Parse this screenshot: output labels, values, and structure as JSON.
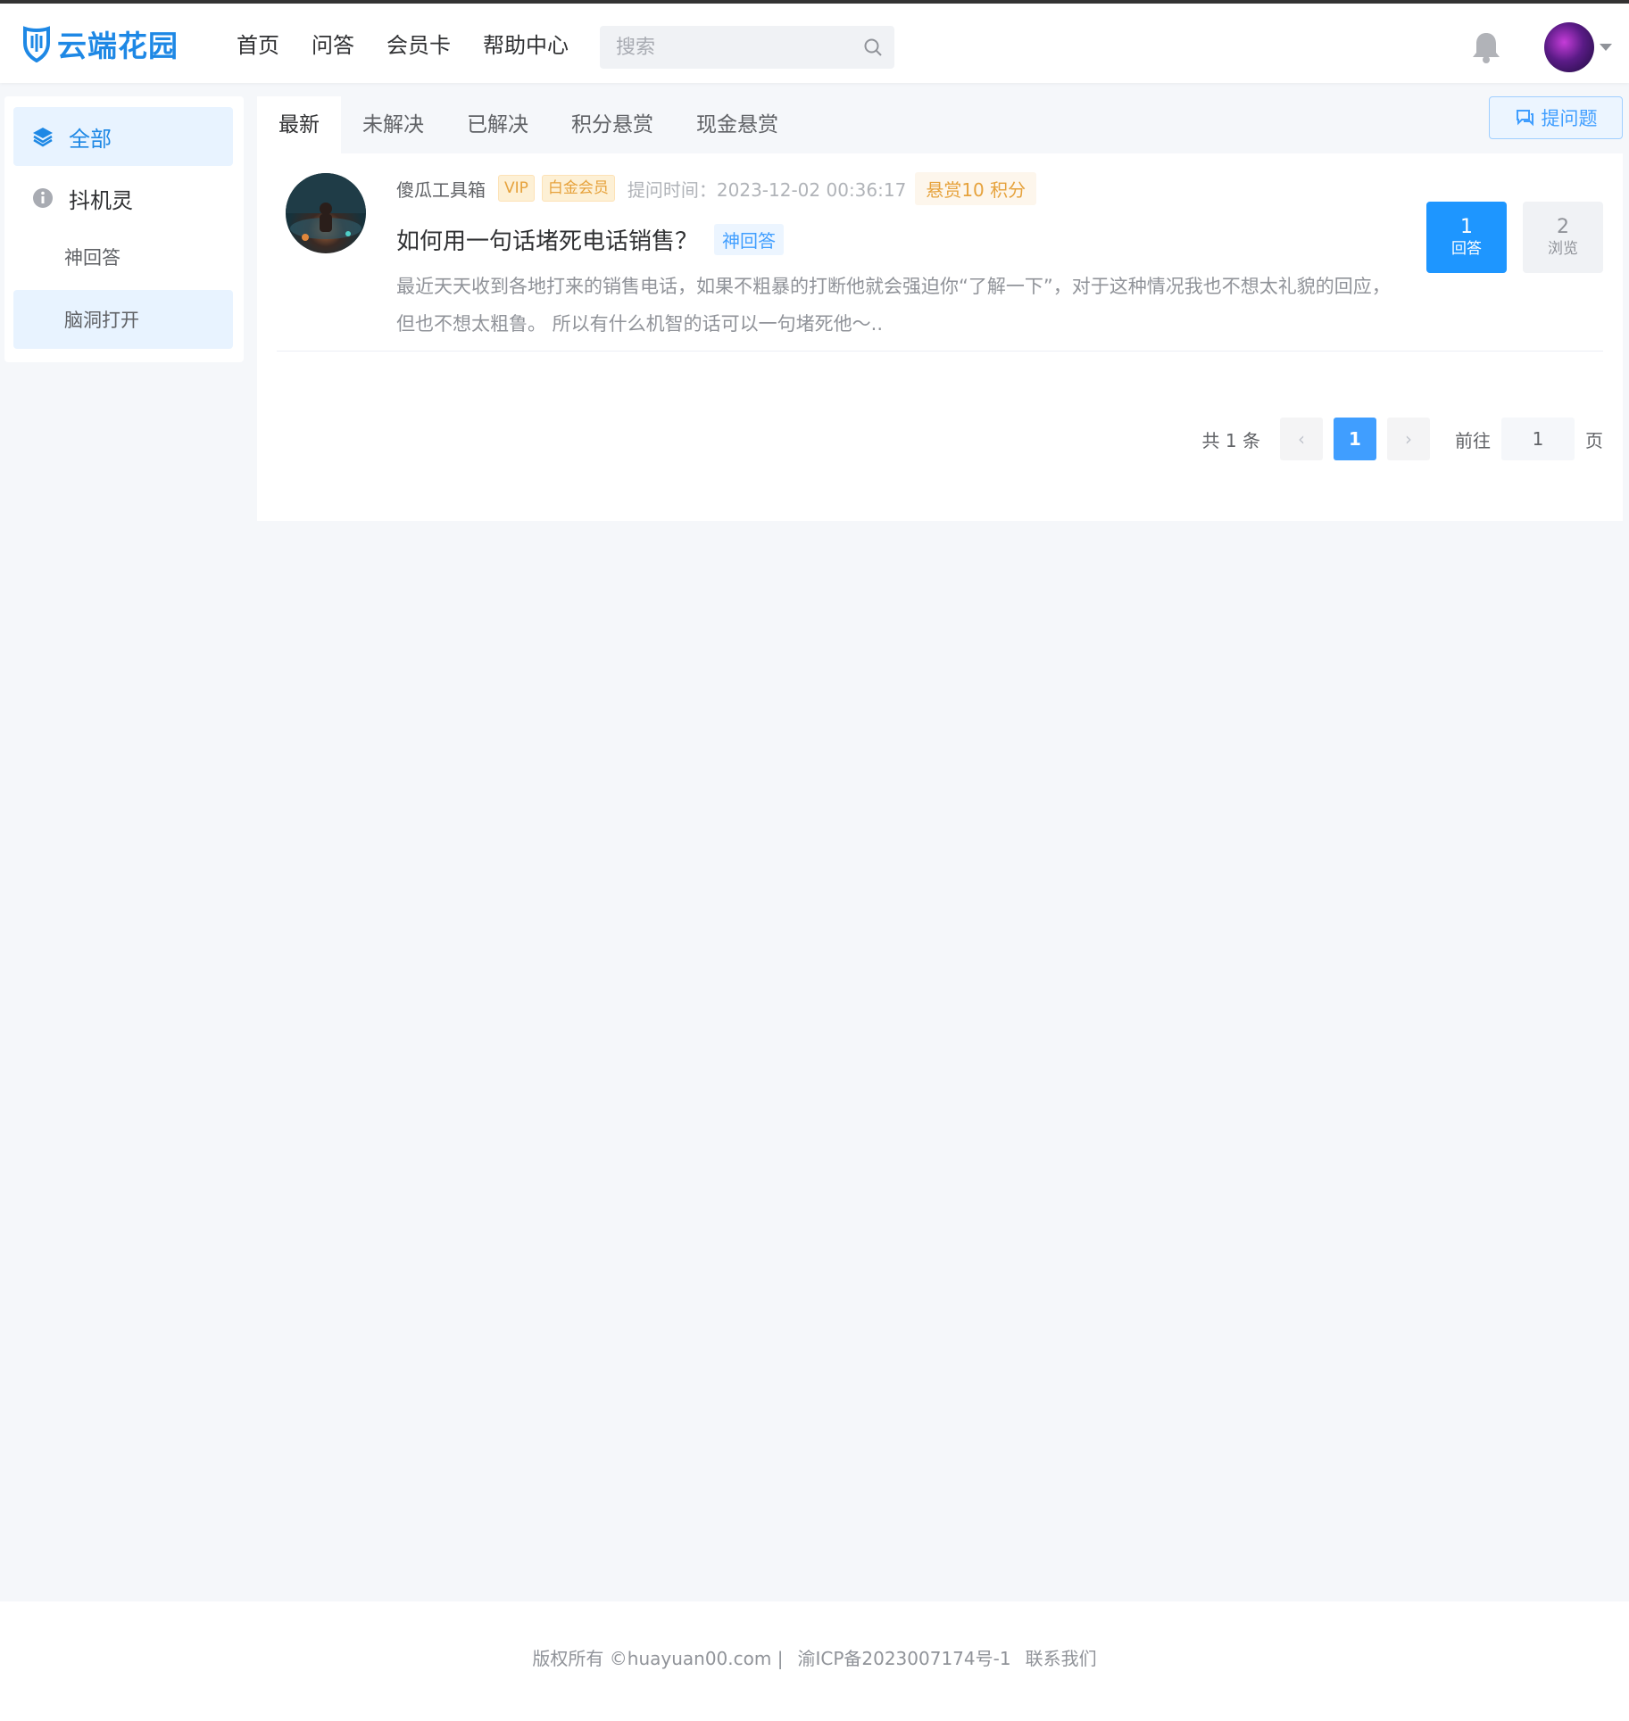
{
  "header": {
    "logo_text": "云端花园",
    "nav": [
      "首页",
      "问答",
      "会员卡",
      "帮助中心"
    ],
    "search_placeholder": "搜索"
  },
  "sidebar": {
    "all_label": "全部",
    "group_label": "抖机灵",
    "subs": [
      "神回答",
      "脑洞打开"
    ]
  },
  "tabs": [
    "最新",
    "未解决",
    "已解决",
    "积分悬赏",
    "现金悬赏"
  ],
  "ask_button": "提问题",
  "question": {
    "user": "傻瓜工具箱",
    "badges": [
      "VIP",
      "白金会员"
    ],
    "time": "提问时间：2023-12-02 00:36:17",
    "reward": "悬赏10 积分",
    "title": "如何用一句话堵死电话销售？",
    "category": "神回答",
    "body": "最近天天收到各地打来的销售电话，如果不粗暴的打断他就会强迫你“了解一下”，对于这种情况我也不想太礼貌的回应，但也不想太粗鲁。 所以有什么机智的话可以一句堵死他～..",
    "answers_count": "1",
    "answers_label": "回答",
    "views_count": "2",
    "views_label": "浏览"
  },
  "pagination": {
    "total": "共 1 条",
    "prev": "‹",
    "current": "1",
    "next": "›",
    "goto_label": "前往",
    "goto_value": "1",
    "page_suffix": "页"
  },
  "footer": {
    "copyright": "版权所有 ©huayuan00.com |",
    "icp": "渝ICP备2023007174号-1",
    "contact": "联系我们"
  },
  "colors": {
    "accent": "#409eff",
    "brand": "#1e88e5",
    "answers_bg": "#1e96ff",
    "reward": "#e6a23c"
  }
}
